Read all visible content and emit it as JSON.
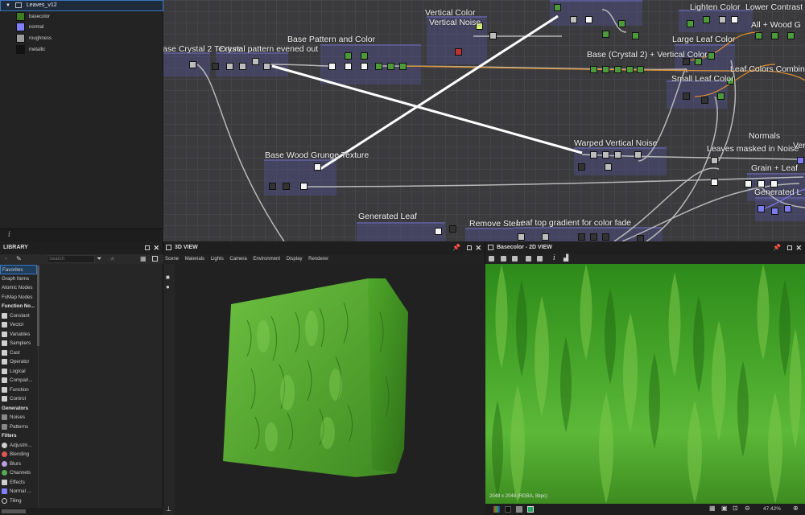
{
  "explorer": {
    "root_label": "Leaves_v12",
    "outputs": [
      {
        "label": "basecolor",
        "color": "#3e7d22"
      },
      {
        "label": "normal",
        "color": "#8080ff"
      },
      {
        "label": "roughness",
        "color": "#9a9a9a"
      },
      {
        "label": "metallic",
        "color": "#121212"
      }
    ],
    "info_icon": "i"
  },
  "graph": {
    "frames": [
      {
        "title": "ase Crystal 2 Texture"
      },
      {
        "title": "Crystal pattern evened out"
      },
      {
        "title": "Base Pattern and Color"
      },
      {
        "title": "Vertical Color"
      },
      {
        "title": "Vertical Noise"
      },
      {
        "title": "Lighten Color"
      },
      {
        "title": "Lower Contrast"
      },
      {
        "title": "All + Wood G"
      },
      {
        "title": "Large Leaf Color"
      },
      {
        "title": "Base (Crystal 2) + Vertical Color"
      },
      {
        "title": "Leaf Colors Combin"
      },
      {
        "title": "Small Leaf Color"
      },
      {
        "title": "Warped Vertical Noise"
      },
      {
        "title": "Normals"
      },
      {
        "title": "Leaves masked in Noise"
      },
      {
        "title": "Ver"
      },
      {
        "title": "Grain + Leaf"
      },
      {
        "title": "Generated L"
      },
      {
        "title": "Base Wood Grunge Texture"
      },
      {
        "title": "Generated Leaf"
      },
      {
        "title": "Remove Stem"
      },
      {
        "title": "Leaf top gradient for color fade"
      }
    ]
  },
  "library": {
    "title": "LIBRARY",
    "search_placeholder": "Search",
    "categories": [
      {
        "label": "Favorites",
        "kind": "item",
        "selected": true
      },
      {
        "label": "Graph Items",
        "kind": "item"
      },
      {
        "label": "Atomic Nodes",
        "kind": "item"
      },
      {
        "label": "FxMap Nodes",
        "kind": "item"
      },
      {
        "label": "Function No...",
        "kind": "header"
      },
      {
        "label": "Constant",
        "kind": "item",
        "icon": "constant-icon"
      },
      {
        "label": "Vector",
        "kind": "item",
        "icon": "vector-icon"
      },
      {
        "label": "Variables",
        "kind": "item",
        "icon": "variables-icon"
      },
      {
        "label": "Samplers",
        "kind": "item",
        "icon": "samplers-icon"
      },
      {
        "label": "Cast",
        "kind": "item",
        "icon": "cast-icon"
      },
      {
        "label": "Operator",
        "kind": "item",
        "icon": "operator-icon"
      },
      {
        "label": "Logical",
        "kind": "item",
        "icon": "logical-icon"
      },
      {
        "label": "Compari...",
        "kind": "item",
        "icon": "comparison-icon"
      },
      {
        "label": "Function",
        "kind": "item",
        "icon": "function-icon"
      },
      {
        "label": "Control",
        "kind": "item",
        "icon": "control-icon"
      },
      {
        "label": "Generators",
        "kind": "header"
      },
      {
        "label": "Noises",
        "kind": "item",
        "icon": "noises-icon"
      },
      {
        "label": "Patterns",
        "kind": "item",
        "icon": "patterns-icon"
      },
      {
        "label": "Filters",
        "kind": "header"
      },
      {
        "label": "Adjustm...",
        "kind": "item",
        "icon": "adjustments-icon"
      },
      {
        "label": "Blending",
        "kind": "item",
        "icon": "blending-icon"
      },
      {
        "label": "Blurs",
        "kind": "item",
        "icon": "blurs-icon"
      },
      {
        "label": "Channels",
        "kind": "item",
        "icon": "channels-icon"
      },
      {
        "label": "Effects",
        "kind": "item",
        "icon": "effects-icon"
      },
      {
        "label": "Normal ...",
        "kind": "item",
        "icon": "normal-icon"
      },
      {
        "label": "Tiling",
        "kind": "item",
        "icon": "tiling-icon"
      }
    ]
  },
  "view3d": {
    "title": "3D VIEW",
    "menu": [
      "Scene",
      "Materials",
      "Lights",
      "Camera",
      "Environment",
      "Display",
      "Renderer"
    ]
  },
  "view2d": {
    "title": "Basecolor - 2D VIEW",
    "resolution_text": "2048 x 2048 (RGBA, 8bpc)",
    "zoom_text": "47.42%"
  },
  "colors": {
    "accent": "#3b7bc8",
    "graph_bg": "#3b3b3e",
    "leaf_green": "#4ca82a"
  }
}
